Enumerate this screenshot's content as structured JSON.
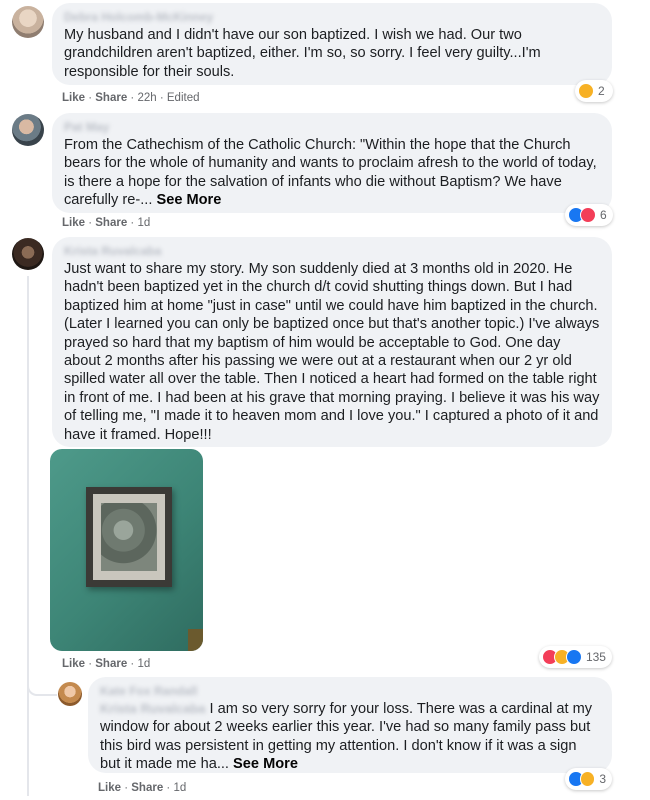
{
  "comments": [
    {
      "author": "Debra Holcomb-McKinney",
      "text": "My husband and I didn't have our son baptized. I wish we had. Our two grandchildren aren't baptized, either. I'm so, so sorry. I feel very guilty...I'm responsible for their souls.",
      "actions": {
        "like": "Like",
        "reply": "Share",
        "time": "22h",
        "edited": "Edited"
      },
      "reactions": {
        "count": "2",
        "types": [
          "sad"
        ]
      }
    },
    {
      "author": "Pat May",
      "text": "From the Cathechism of the Catholic Church: \"Within the hope that the Church bears for the whole of humanity and wants to proclaim afresh to the world of today, is there a hope for the salvation of infants who die without Baptism? We have carefully re-...",
      "see_more": "See More",
      "actions": {
        "like": "Like",
        "reply": "Share",
        "time": "1d"
      },
      "reactions": {
        "count": "6",
        "types": [
          "like",
          "love"
        ]
      }
    },
    {
      "author": "Krista Ruvalcaba",
      "text": "Just want to share my story. My son suddenly died at 3 months old in 2020. He hadn't been baptized yet in the church d/t covid shutting things down. But I had baptized him at home \"just in case\" until we could have him baptized in the church. (Later I learned you can only be baptized once but that's another topic.) I've always prayed so hard that my baptism of him would be acceptable to God. One day about 2 months after his passing we were out at a restaurant when our 2 yr old spilled water all over the table. Then I noticed a heart had formed on the table right in front of me. I had been at his grave that morning praying. I believe it was his way of telling me, \"I made it to heaven mom and I love you.\" I captured a photo of it and have it framed. Hope!!!",
      "actions": {
        "like": "Like",
        "reply": "Share",
        "time": "1d"
      },
      "reactions": {
        "count": "135",
        "types": [
          "love",
          "care",
          "like"
        ]
      }
    }
  ],
  "reply": {
    "author": "Kate Fox Randall",
    "mention": "Krista Ruvalcaba",
    "text": " I am so very sorry for your loss. There was a cardinal at my window for about 2 weeks earlier this year. I've had so many family pass but this bird was persistent in getting my attention. I don't know if it was a sign but it made me ha...",
    "see_more": "See More",
    "actions": {
      "like": "Like",
      "reply": "Share",
      "time": "1d"
    },
    "reactions": {
      "count": "3",
      "types": [
        "like",
        "care"
      ]
    }
  }
}
